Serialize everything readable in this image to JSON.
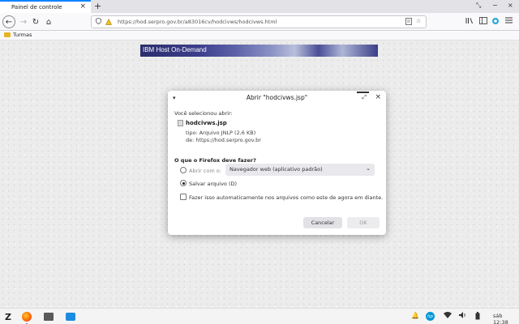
{
  "browser": {
    "tab": {
      "title": "Painel de controle",
      "close_glyph": "×"
    },
    "new_tab_glyph": "+",
    "window_controls": [
      "⤡",
      "−",
      "×"
    ],
    "nav": {
      "back_glyph": "←",
      "forward_glyph": "→",
      "reload_glyph": "↻",
      "home_glyph": "⌂"
    },
    "url": "https://hod.serpro.gov.br/a83016cv/hodcivws/hodcivws.html",
    "url_icons": [
      "shield-icon",
      "warning-lock-icon"
    ],
    "toolbar_icons": [
      "bookmark-star-icon",
      "library-icon",
      "reader-icon",
      "extension-icon",
      "menu-icon"
    ],
    "bookmarks": [
      {
        "label": "Turmas"
      }
    ]
  },
  "page": {
    "banner_text": "IBM Host On-Demand"
  },
  "dialog": {
    "title": "Abrir \"hodcivws.jsp\"",
    "selected_label": "Você selecionou abrir:",
    "file": {
      "name": "hodcivws.jsp",
      "type_line": "tipo: Arquivo JNLP (2,6 KB)",
      "from_line": "de:  https://hod.serpro.gov.br"
    },
    "question": "O que o Firefox deve fazer?",
    "open_with_label": "Abrir com o:",
    "open_with_value": "Navegador web (aplicativo padrão)",
    "save_label": "Salvar arquivo (D)",
    "auto_label": "Fazer isso automaticamente nos arquivos como este de agora em diante.",
    "cancel_label": "Cancelar",
    "ok_label": "OK",
    "selected_option": "save"
  },
  "taskbar": {
    "time": "sáb 12:38",
    "hp_label": "hp"
  }
}
